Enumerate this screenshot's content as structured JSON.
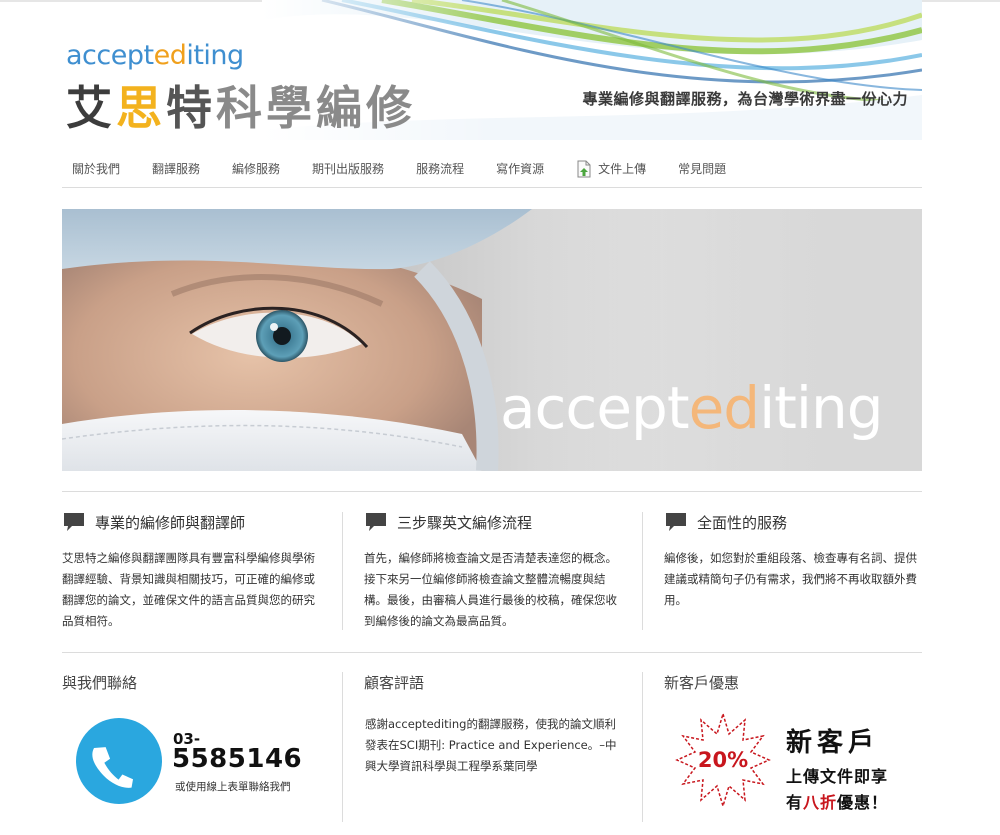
{
  "header": {
    "logo_en_pre": "accept",
    "logo_en_ed": "ed",
    "logo_en_post": "iting",
    "logo_cn": [
      "艾",
      "思",
      "特",
      "科學編修"
    ],
    "tagline": "專業編修與翻譯服務，為台灣學術界盡一份心力"
  },
  "nav": {
    "items": [
      "關於我們",
      "翻譯服務",
      "編修服務",
      "期刊出版服務",
      "服務流程",
      "寫作資源",
      "文件上傳",
      "常見問題"
    ]
  },
  "hero": {
    "word_pre": "accept",
    "word_ed": "ed",
    "word_post": "iting"
  },
  "features": [
    {
      "title": "專業的編修師與翻譯師",
      "body": "艾思特之編修與翻譯團隊具有豐富科學編修與學術翻譯經驗、背景知識與相關技巧，可正確的編修或翻譯您的論文，並確保文件的語言品質與您的研究品質相符。"
    },
    {
      "title": "三步驟英文編修流程",
      "body": "首先，編修師將檢查論文是否清楚表達您的概念。接下來另一位編修師將檢查論文整體流暢度與結構。最後，由審稿人員進行最後的校稿，確保您收到編修後的論文為最高品質。"
    },
    {
      "title": "全面性的服務",
      "body": "編修後，如您對於重組段落、檢查專有名詞、提供建議或精簡句子仍有需求，我們將不再收取額外費用。"
    }
  ],
  "contact": {
    "title": "與我們聯絡",
    "area_code": "03-",
    "number": "5585146",
    "note": "或使用線上表單聯絡我們"
  },
  "testimonials": {
    "title": "顧客評語",
    "text": "感謝acceptediting的翻譯服務，使我的論文順利發表在SCI期刊: Practice and Experience。–中興大學資訊科學與工程學系葉同學"
  },
  "promo": {
    "title": "新客戶優惠",
    "badge": "20%",
    "line1": "新客戶",
    "line2": "上傳文件即享",
    "line3_pre": "有",
    "line3_red": "八折",
    "line3_post": "優惠！",
    "accent_color": "#c8161d"
  },
  "colors": {
    "brand_blue": "#3f8fd0",
    "brand_orange": "#f0a01c",
    "phone_blue": "#2aa7df"
  }
}
